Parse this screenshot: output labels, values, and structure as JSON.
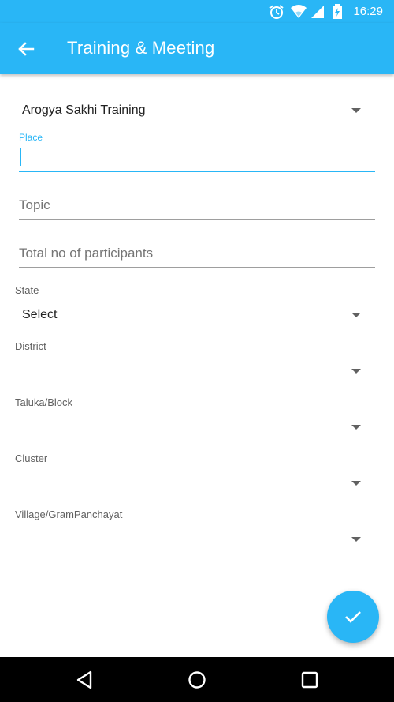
{
  "status_bar": {
    "time": "16:29",
    "icons": [
      "alarm-icon",
      "wifi-icon",
      "signal-icon",
      "battery-charging-icon"
    ]
  },
  "app_bar": {
    "back_icon": "arrow-back-icon",
    "title": "Training & Meeting"
  },
  "form": {
    "training_type": {
      "selected": "Arogya Sakhi Training"
    },
    "place": {
      "label": "Place",
      "value": ""
    },
    "topic": {
      "placeholder": "Topic",
      "value": ""
    },
    "participants": {
      "placeholder": "Total no of participants",
      "value": ""
    },
    "state": {
      "label": "State",
      "selected": "Select"
    },
    "district": {
      "label": "District",
      "selected": ""
    },
    "taluka": {
      "label": "Taluka/Block",
      "selected": ""
    },
    "cluster": {
      "label": "Cluster",
      "selected": ""
    },
    "village": {
      "label": "Village/GramPanchayat",
      "selected": ""
    }
  },
  "fab": {
    "icon": "check-icon"
  },
  "nav_bar": {
    "buttons": [
      "back-triangle-icon",
      "home-circle-icon",
      "recents-square-icon"
    ]
  },
  "colors": {
    "primary": "#29b6f6",
    "text_primary": "#212121",
    "text_hint": "#757575",
    "label": "#616161"
  }
}
